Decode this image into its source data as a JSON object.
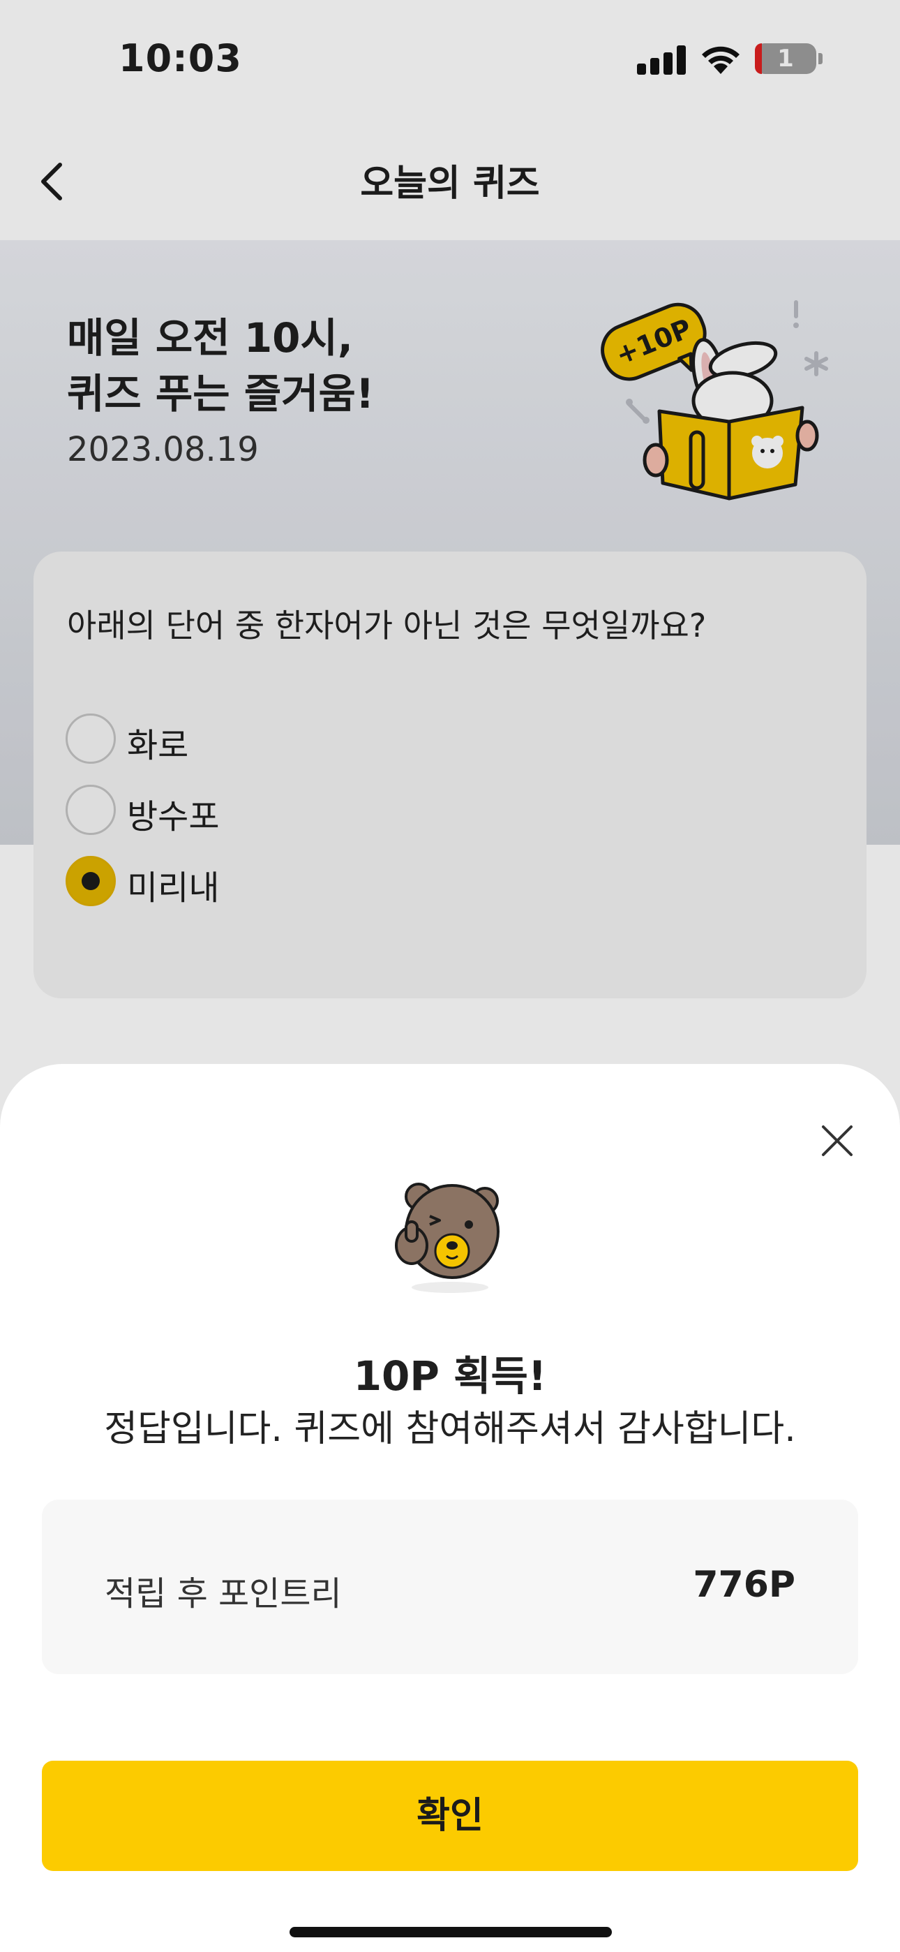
{
  "status_bar": {
    "time": "10:03",
    "battery_level": "1"
  },
  "header": {
    "title": "오늘의 퀴즈",
    "back_icon": "chevron-left-icon"
  },
  "hero": {
    "headline_line1": "매일 오전 10시,",
    "headline_line2": "퀴즈 푸는 즐거움!",
    "date": "2023.08.19",
    "badge": "+10P"
  },
  "quiz": {
    "question": "아래의 단어 중 한자어가 아닌 것은 무엇일까요?",
    "options": [
      {
        "label": "화로",
        "selected": false
      },
      {
        "label": "방수포",
        "selected": false
      },
      {
        "label": "미리내",
        "selected": true
      }
    ]
  },
  "result_sheet": {
    "reward": "10P 획득!",
    "message": "정답입니다. 퀴즈에 참여해주셔서 감사합니다.",
    "points_label": "적립 후 포인트리",
    "points_value": "776P",
    "confirm_label": "확인",
    "close_icon": "close-icon"
  },
  "colors": {
    "accent": "#fccb00",
    "selected_radio": "#e2b500"
  }
}
